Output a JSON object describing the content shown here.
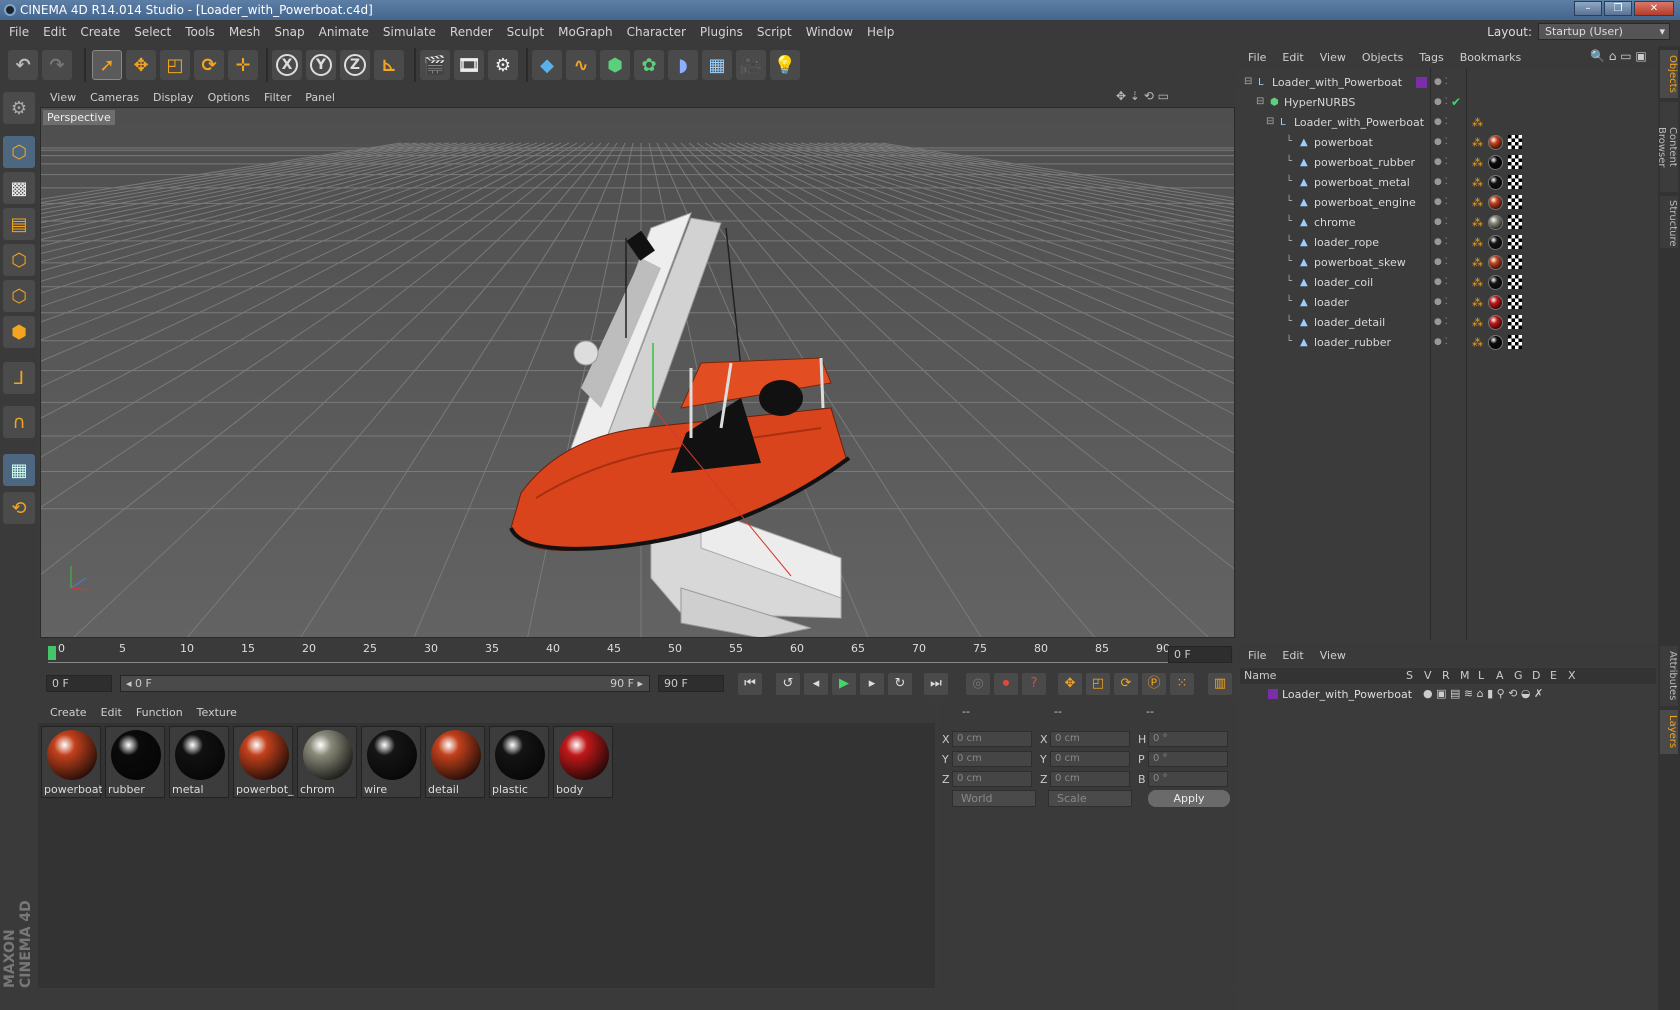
{
  "window": {
    "title": "CINEMA 4D R14.014 Studio - [Loader_with_Powerboat.c4d]",
    "min": "–",
    "max": "❐",
    "close": "✕"
  },
  "menu": [
    "File",
    "Edit",
    "Create",
    "Select",
    "Tools",
    "Mesh",
    "Snap",
    "Animate",
    "Simulate",
    "Render",
    "Sculpt",
    "MoGraph",
    "Character",
    "Plugins",
    "Script",
    "Window",
    "Help"
  ],
  "layout": {
    "label": "Layout:",
    "value": "Startup (User)"
  },
  "viewport": {
    "menu": [
      "View",
      "Cameras",
      "Display",
      "Options",
      "Filter",
      "Panel"
    ],
    "label": "Perspective"
  },
  "timeline": {
    "ticks": [
      "0",
      "5",
      "10",
      "15",
      "20",
      "25",
      "30",
      "35",
      "40",
      "45",
      "50",
      "55",
      "60",
      "65",
      "70",
      "75",
      "80",
      "85",
      "90"
    ],
    "current_frame": "0 F",
    "start": "0 F",
    "range_start": "◂ 0 F",
    "range_end": "90 F ▸",
    "end": "90 F"
  },
  "materials": {
    "menu": [
      "Create",
      "Edit",
      "Function",
      "Texture"
    ],
    "items": [
      {
        "label": "powerboat",
        "color": "#c2401c"
      },
      {
        "label": "rubber",
        "color": "#0a0a0a"
      },
      {
        "label": "metal",
        "color": "#111111"
      },
      {
        "label": "powerbot_",
        "color": "#c2401c"
      },
      {
        "label": "chrom",
        "color": "#8a8a7a"
      },
      {
        "label": "wire",
        "color": "#151515"
      },
      {
        "label": "detail",
        "color": "#c2401c"
      },
      {
        "label": "plastic",
        "color": "#141414"
      },
      {
        "label": "body",
        "color": "#c01818"
      }
    ]
  },
  "attributes": {
    "headers": [
      "--",
      "--",
      "--"
    ],
    "rows": [
      {
        "a": "X",
        "av": "0 cm",
        "b": "X",
        "bv": "0 cm",
        "c": "H",
        "cv": "0 °"
      },
      {
        "a": "Y",
        "av": "0 cm",
        "b": "Y",
        "bv": "0 cm",
        "c": "P",
        "cv": "0 °"
      },
      {
        "a": "Z",
        "av": "0 cm",
        "b": "Z",
        "bv": "0 cm",
        "c": "B",
        "cv": "0 °"
      }
    ],
    "world": "World",
    "scale": "Scale",
    "apply": "Apply"
  },
  "objects": {
    "menu": [
      "File",
      "Edit",
      "View",
      "Objects",
      "Tags",
      "Bookmarks"
    ],
    "rows": [
      {
        "name": "Loader_with_Powerboat",
        "level": 0,
        "kind": "null"
      },
      {
        "name": "HyperNURBS",
        "level": 1,
        "kind": "nurbs"
      },
      {
        "name": "Loader_with_Powerboat",
        "level": 2,
        "kind": "null"
      },
      {
        "name": "powerboat",
        "level": 3,
        "kind": "mesh",
        "tag": "#c2401c"
      },
      {
        "name": "powerboat_rubber",
        "level": 3,
        "kind": "mesh",
        "tag": "#0a0a0a"
      },
      {
        "name": "powerboat_metal",
        "level": 3,
        "kind": "mesh",
        "tag": "#111111"
      },
      {
        "name": "powerboat_engine",
        "level": 3,
        "kind": "mesh",
        "tag": "#c2401c"
      },
      {
        "name": "chrome",
        "level": 3,
        "kind": "mesh",
        "tag": "#8a8a7a"
      },
      {
        "name": "loader_rope",
        "level": 3,
        "kind": "mesh",
        "tag": "#151515"
      },
      {
        "name": "powerboat_skew",
        "level": 3,
        "kind": "mesh",
        "tag": "#c2401c"
      },
      {
        "name": "loader_coil",
        "level": 3,
        "kind": "mesh",
        "tag": "#141414"
      },
      {
        "name": "loader",
        "level": 3,
        "kind": "mesh",
        "tag": "#c01818"
      },
      {
        "name": "loader_detail",
        "level": 3,
        "kind": "mesh",
        "tag": "#c01818"
      },
      {
        "name": "loader_rubber",
        "level": 3,
        "kind": "mesh",
        "tag": "#0a0a0a"
      }
    ]
  },
  "layers": {
    "menu": [
      "File",
      "Edit",
      "View"
    ],
    "columns": [
      "Name",
      "S",
      "V",
      "R",
      "M",
      "L",
      "A",
      "G",
      "D",
      "E",
      "X"
    ],
    "rows": [
      {
        "name": "Loader_with_Powerboat",
        "color": "#7a2fa8"
      }
    ]
  },
  "right_tabs": [
    "Objects",
    "Content Browser",
    "Structure",
    "Attributes",
    "Layers"
  ],
  "branding": "MAXON CINEMA 4D",
  "colors": {
    "accent": "#f3a520",
    "selection": "#4e6780",
    "boat": "#d9441c"
  }
}
